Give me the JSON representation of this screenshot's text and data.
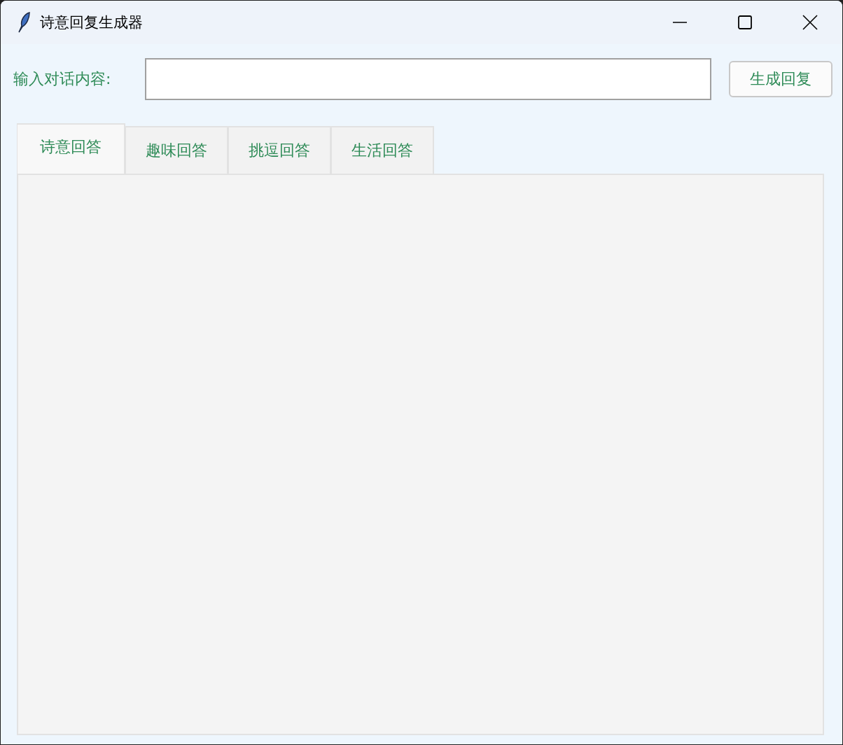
{
  "window": {
    "title": "诗意回复生成器"
  },
  "input": {
    "label": "输入对话内容:"
  },
  "generate_button": {
    "label": "生成回复"
  },
  "tabs": [
    {
      "label": "诗意回答",
      "selected": true
    },
    {
      "label": "趣味回答",
      "selected": false
    },
    {
      "label": "挑逗回答",
      "selected": false
    },
    {
      "label": "生活回答",
      "selected": false
    }
  ]
}
